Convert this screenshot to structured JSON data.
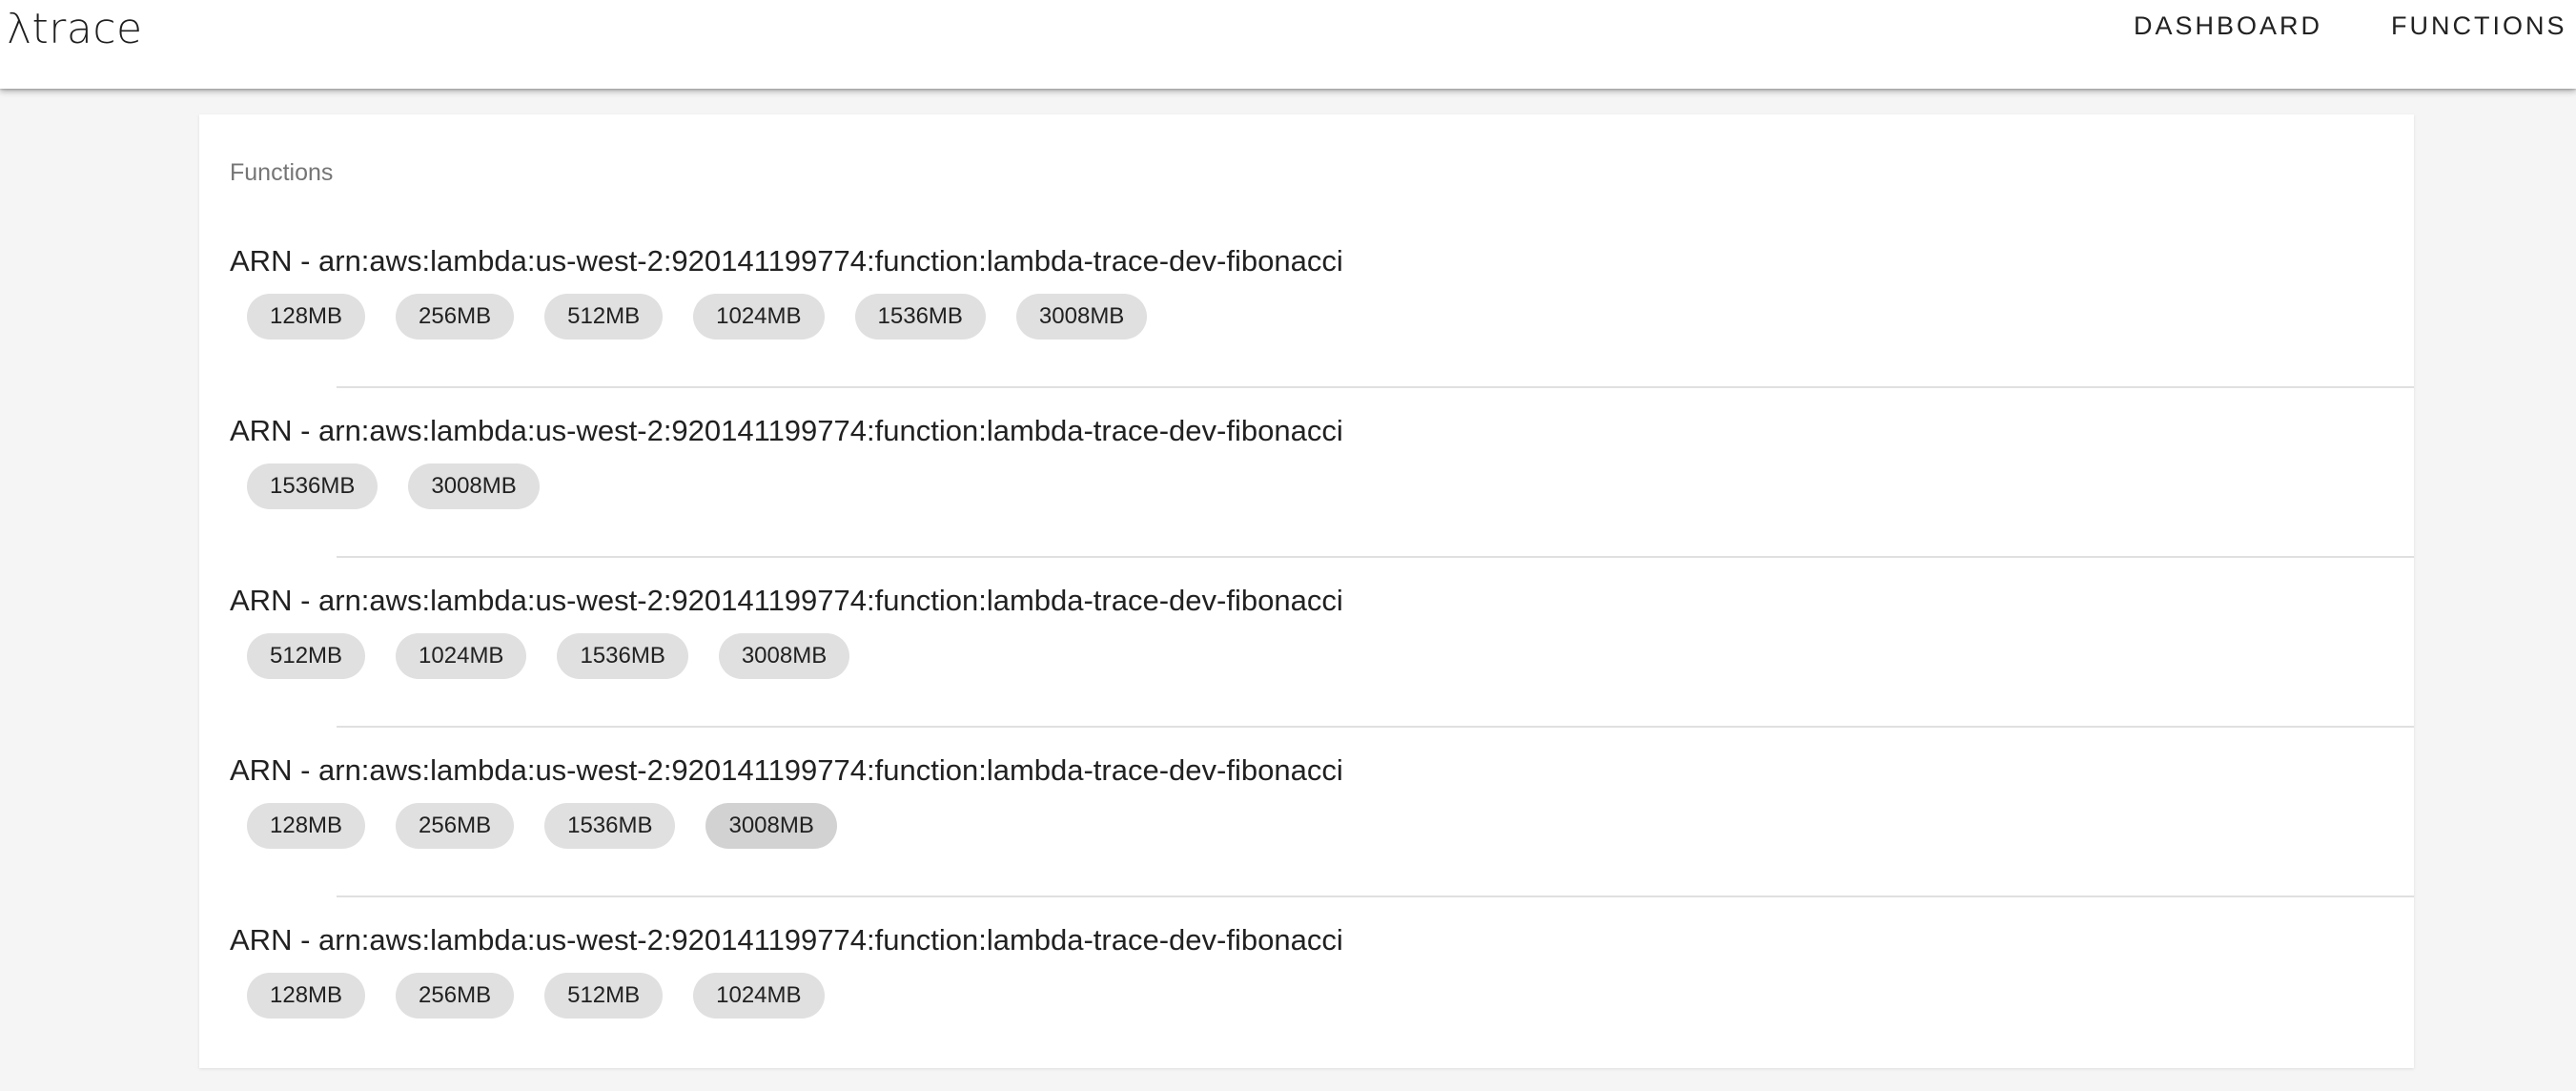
{
  "appbar": {
    "logo": "λtrace",
    "nav": [
      "DASHBOARD",
      "FUNCTIONS"
    ]
  },
  "main": {
    "subheader": "Functions",
    "functions": [
      {
        "title": "ARN - arn:aws:lambda:us-west-2:920141199774:function:lambda-trace-dev-fibonacci",
        "memory": [
          "128MB",
          "256MB",
          "512MB",
          "1024MB",
          "1536MB",
          "3008MB"
        ]
      },
      {
        "title": "ARN - arn:aws:lambda:us-west-2:920141199774:function:lambda-trace-dev-fibonacci",
        "memory": [
          "1536MB",
          "3008MB"
        ]
      },
      {
        "title": "ARN - arn:aws:lambda:us-west-2:920141199774:function:lambda-trace-dev-fibonacci",
        "memory": [
          "512MB",
          "1024MB",
          "1536MB",
          "3008MB"
        ]
      },
      {
        "title": "ARN - arn:aws:lambda:us-west-2:920141199774:function:lambda-trace-dev-fibonacci",
        "memory": [
          "128MB",
          "256MB",
          "1536MB",
          "3008MB"
        ]
      },
      {
        "title": "ARN - arn:aws:lambda:us-west-2:920141199774:function:lambda-trace-dev-fibonacci",
        "memory": [
          "128MB",
          "256MB",
          "512MB",
          "1024MB"
        ]
      }
    ]
  }
}
